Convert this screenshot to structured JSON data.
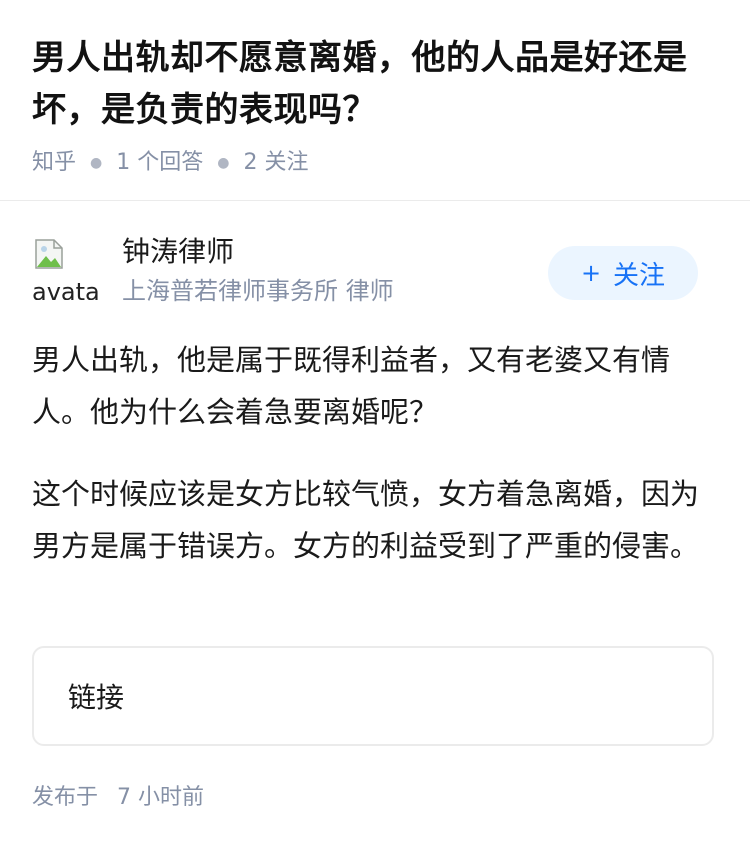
{
  "question": {
    "title": "男人出轨却不愿意离婚，他的人品是好还是坏，是负责的表现吗？",
    "source": "知乎",
    "answers_count": "1 个回答",
    "followers_count": "2 关注"
  },
  "author": {
    "avatar_alt": "avatar",
    "name": "钟涛律师",
    "description": "上海普若律师事务所 律师",
    "follow_label": "关注",
    "follow_plus": "+"
  },
  "answer": {
    "paragraphs": [
      "男人出轨，他是属于既得利益者，又有老婆又有情人。他为什么会着急要离婚呢？",
      "这个时候应该是女方比较气愤，女方着急离婚，因为男方是属于错误方。女方的利益受到了严重的侵害。"
    ],
    "link_label": "链接",
    "published_prefix": "发布于",
    "published_time": "7 小时前"
  },
  "colors": {
    "accent": "#1772f6",
    "accent_bg": "#ebf5ff",
    "meta_text": "#8590a6",
    "divider": "#ebebeb"
  },
  "icons": {
    "avatar": "broken-image-icon"
  }
}
